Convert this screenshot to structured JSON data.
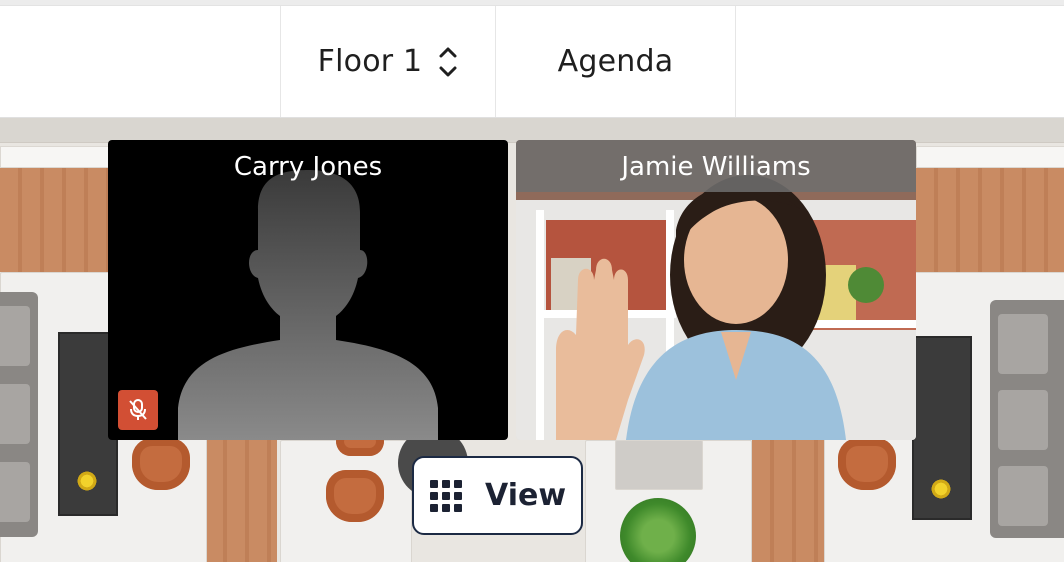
{
  "topbar": {
    "floor_label": "Floor 1",
    "agenda_label": "Agenda"
  },
  "participants": [
    {
      "name": "Carry Jones",
      "video": false,
      "muted": true
    },
    {
      "name": "Jamie Williams",
      "video": true,
      "muted": false
    }
  ],
  "view_button": {
    "label": "View",
    "icon": "grid-icon"
  },
  "colors": {
    "mute_badge": "#d24f34",
    "view_border": "#1c2a44",
    "name_bar": "#6e6e6e"
  }
}
